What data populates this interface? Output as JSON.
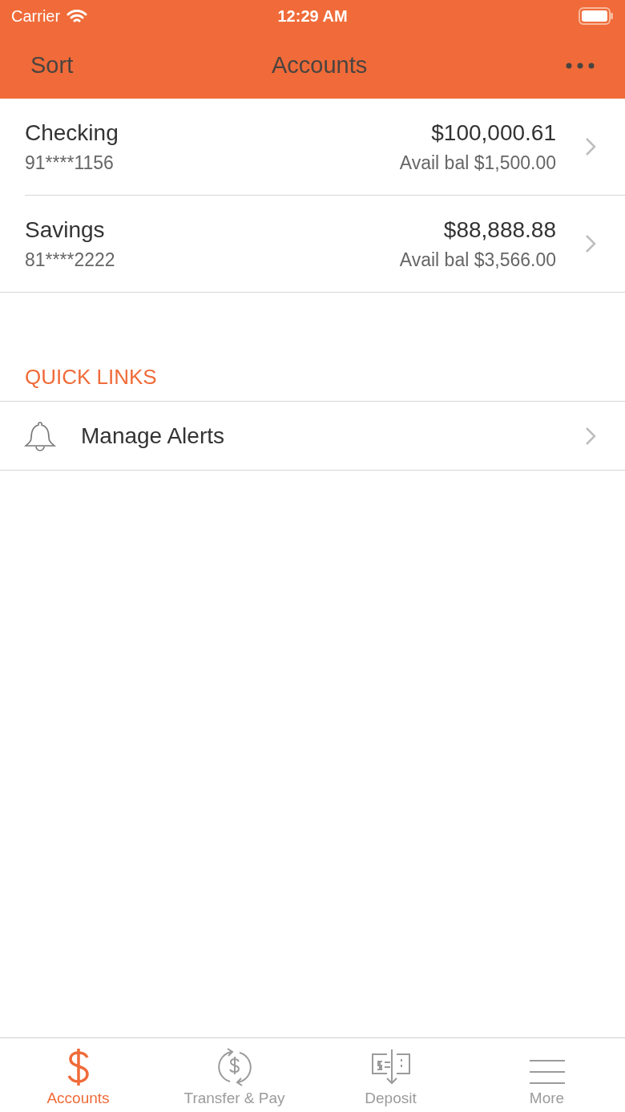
{
  "status_bar": {
    "carrier": "Carrier",
    "time": "12:29 AM"
  },
  "nav": {
    "left": "Sort",
    "title": "Accounts"
  },
  "accounts": [
    {
      "name": "Checking",
      "number": "91****1156",
      "balance": "$100,000.61",
      "available": "Avail bal $1,500.00"
    },
    {
      "name": "Savings",
      "number": "81****2222",
      "balance": "$88,888.88",
      "available": "Avail bal $3,566.00"
    }
  ],
  "quick_links": {
    "heading": "QUICK LINKS",
    "items": [
      {
        "label": "Manage Alerts"
      }
    ]
  },
  "tab_bar": [
    {
      "label": "Accounts",
      "kind": "dollar",
      "selected": true
    },
    {
      "label": "Transfer & Pay",
      "kind": "transfer",
      "selected": false
    },
    {
      "label": "Deposit",
      "kind": "deposit",
      "selected": false
    },
    {
      "label": "More",
      "kind": "menu",
      "selected": false
    }
  ]
}
